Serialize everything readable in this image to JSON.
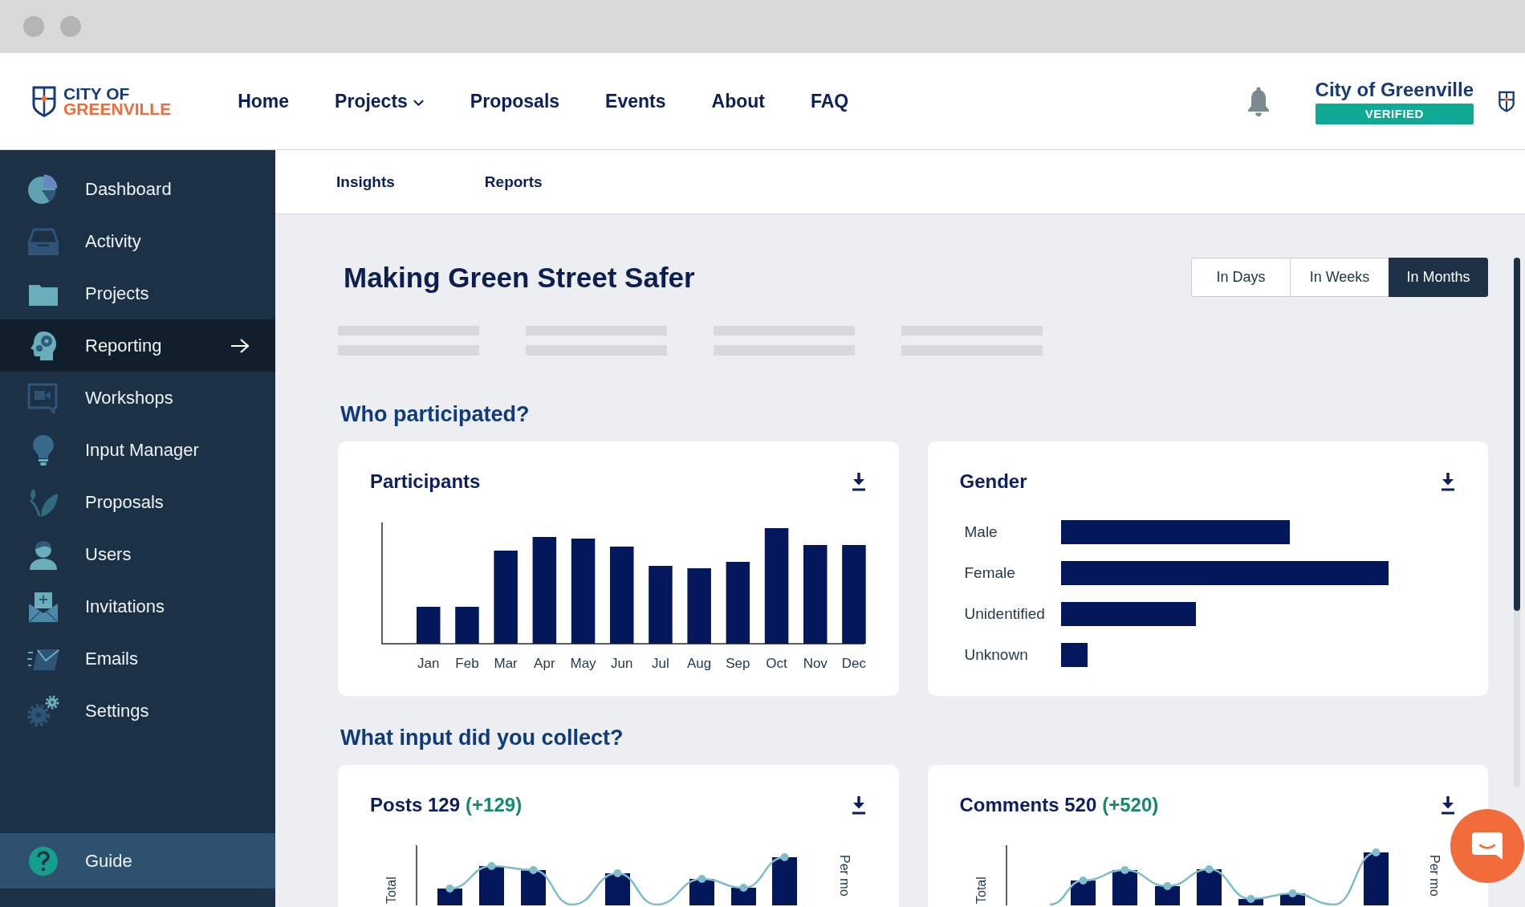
{
  "header": {
    "logo": {
      "line_1": "CITY OF",
      "line_2": "GREENVILLE"
    },
    "nav": [
      {
        "label": "Home",
        "dropdown": false
      },
      {
        "label": "Projects",
        "dropdown": true
      },
      {
        "label": "Proposals",
        "dropdown": false
      },
      {
        "label": "Events",
        "dropdown": false
      },
      {
        "label": "About",
        "dropdown": false
      },
      {
        "label": "FAQ",
        "dropdown": false
      }
    ],
    "account": {
      "name": "City of Greenville",
      "badge": "VERIFIED"
    }
  },
  "sidebar": {
    "items": [
      {
        "label": "Dashboard",
        "selected": false
      },
      {
        "label": "Activity",
        "selected": false
      },
      {
        "label": "Projects",
        "selected": false
      },
      {
        "label": "Reporting",
        "selected": true
      },
      {
        "label": "Workshops",
        "selected": false
      },
      {
        "label": "Input Manager",
        "selected": false
      },
      {
        "label": "Proposals",
        "selected": false
      },
      {
        "label": "Users",
        "selected": false
      },
      {
        "label": "Invitations",
        "selected": false
      },
      {
        "label": "Emails",
        "selected": false
      },
      {
        "label": "Settings",
        "selected": false
      }
    ],
    "footer_item": {
      "label": "Guide"
    }
  },
  "subnav": {
    "tabs": [
      {
        "label": "Insights"
      },
      {
        "label": "Reports"
      }
    ]
  },
  "page": {
    "title": "Making Green Street Safer",
    "ranges": [
      {
        "label": "In Days",
        "selected": false
      },
      {
        "label": "In Weeks",
        "selected": false
      },
      {
        "label": "In Months",
        "selected": true
      }
    ]
  },
  "sections": [
    {
      "heading": "Who participated?",
      "cards": [
        {
          "kind": "column_chart",
          "title": "Participants",
          "x_labels": [
            "Jan",
            "Feb",
            "Mar",
            "Apr",
            "May",
            "Jun",
            "Jul",
            "Aug",
            "Sep",
            "Oct",
            "Nov",
            "Dec"
          ]
        },
        {
          "kind": "bar_list",
          "title": "Gender",
          "labels": [
            "Male",
            "Female",
            "Unidentified",
            "Unknown"
          ]
        }
      ]
    },
    {
      "heading": "What input did you collect?",
      "cards": [
        {
          "kind": "combo_chart",
          "title": "Posts 129",
          "change": "(+129)",
          "left_axis_title": "Total",
          "right_axis_title": "Per mo"
        },
        {
          "kind": "combo_chart",
          "title": "Comments 520",
          "change": "(+520)",
          "left_axis_title": "Total",
          "right_axis_title": "Per mo"
        }
      ]
    }
  ]
}
